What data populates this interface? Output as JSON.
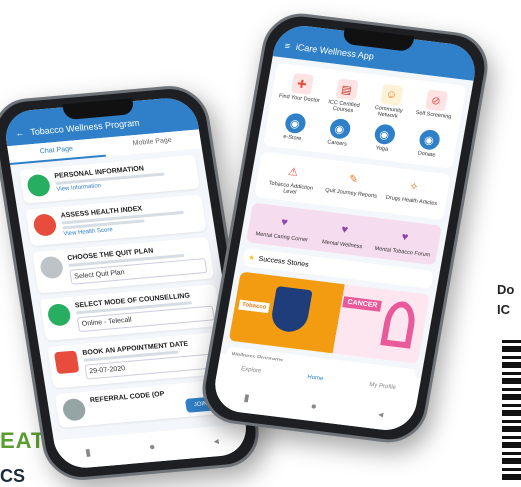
{
  "side": {
    "eat": "EAT",
    "cs": "CS",
    "do": "Do",
    "ic": "IC"
  },
  "left_phone": {
    "title": "Tobacco Wellness Program",
    "tabs": [
      "Chat Page",
      "Mobile Page"
    ],
    "cards": [
      {
        "title": "PERSONAL INFORMATION",
        "link": "View Information"
      },
      {
        "title": "ASSESS HEALTH INDEX",
        "link": "View Health Score"
      },
      {
        "title": "CHOOSE THE QUIT PLAN",
        "value": "Select Quit Plan"
      },
      {
        "title": "SELECT MODE OF COUNSELLING",
        "value": "Online - Telecall"
      },
      {
        "title": "BOOK AN APPOINTMENT DATE",
        "value": "29-07-2020"
      },
      {
        "title": "REFERRAL CODE (OP"
      }
    ],
    "join_button": "JOIN NOW"
  },
  "right_phone": {
    "title": "iCare Wellness App",
    "grid": [
      "Find Your Doctor",
      "ICC Certified Courses",
      "Community Network",
      "Self Screening",
      "e-Store",
      "Careers",
      "Yoga",
      "Donate"
    ],
    "row3": [
      "Tobacco Addiction Level",
      "Quit Journey Reports",
      "Drugs Health Articles"
    ],
    "row3b": [
      "Mental Caring Corner",
      "Mental Wellness",
      "Mental Tobacco Forum"
    ],
    "success_title": "Success Stories",
    "banner": {
      "left": "Tobacco",
      "right": "CANCER"
    },
    "footer_title": "Wellness Programs",
    "nav": [
      "Explore",
      "Home",
      "My Profile"
    ]
  }
}
